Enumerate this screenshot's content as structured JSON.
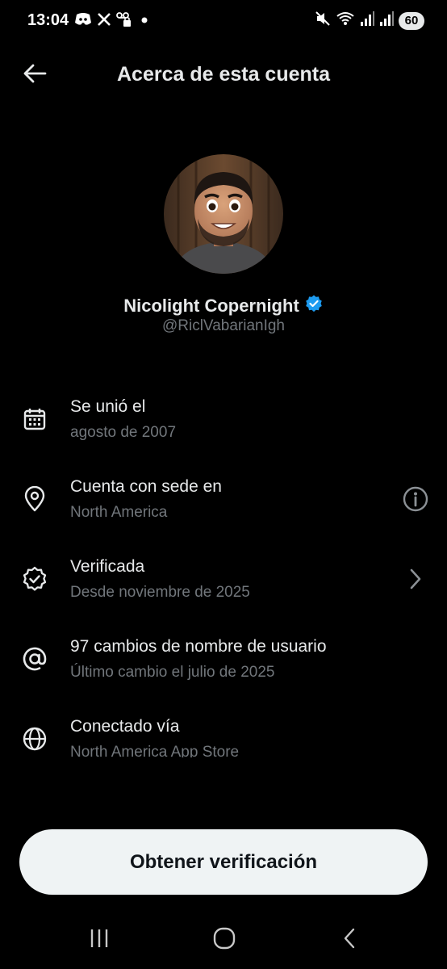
{
  "status_bar": {
    "time": "13:04",
    "left_icons": [
      "discord-icon",
      "x-icon",
      "voicemail-lock-icon",
      "dot-icon"
    ],
    "right_icons": [
      "mute-vibrate-icon",
      "wifi-icon",
      "signal-icon",
      "signal-icon"
    ],
    "battery": "60"
  },
  "header": {
    "title": "Acerca de esta cuenta",
    "back_icon": "arrow-left-icon"
  },
  "profile": {
    "display_name": "Nicolight Copernight",
    "handle": "@RiclVabarianIgh",
    "verified": true,
    "verified_color": "#1d9bf0"
  },
  "info": {
    "items": [
      {
        "icon": "calendar-icon",
        "title": "Se unió el",
        "subtitle": "agosto de 2007"
      },
      {
        "icon": "location-pin-icon",
        "title": "Cuenta con sede en",
        "subtitle": "North America",
        "action_icon": "info-icon"
      },
      {
        "icon": "verified-badge-icon",
        "title": "Verificada",
        "subtitle": "Desde noviembre de 2025",
        "action_icon": "chevron-right-icon"
      },
      {
        "icon": "at-sign-icon",
        "title": "97 cambios de nombre de usuario",
        "subtitle": "Último cambio el julio de 2025"
      },
      {
        "icon": "globe-icon",
        "title": "Conectado vía",
        "subtitle": "North America App Store"
      }
    ]
  },
  "cta": {
    "label": "Obtener verificación"
  },
  "nav": {
    "recents": "recents-icon",
    "home": "home-icon",
    "back": "back-icon"
  },
  "colors": {
    "background": "#000000",
    "text": "#e7e9ea",
    "muted": "#71767b",
    "cta_bg": "#eff3f4"
  }
}
